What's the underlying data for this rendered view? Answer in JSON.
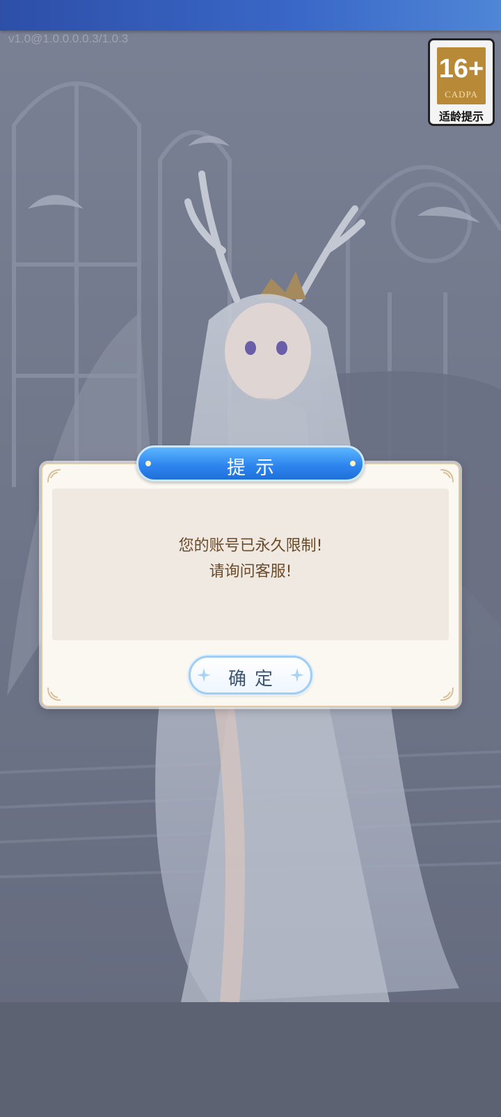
{
  "version_text": "v1.0@1.0.0.0.0.3/1.0.3",
  "age_rating": {
    "age": "16+",
    "org": "CADPA",
    "label": "适龄提示"
  },
  "dialog": {
    "title": "提示",
    "message_line1": "您的账号已永久限制!",
    "message_line2": "请询问客服!",
    "ok_label": "确定"
  },
  "icons": {
    "topbar_emblem": "heart-emblem-icon",
    "corner": "ornament-corner-icon",
    "sparkle": "sparkle-icon"
  },
  "colors": {
    "title_blue": "#2f86ee",
    "message_brown": "#6b4a2a",
    "age_gold": "#b88a38",
    "dim_overlay": "#6d7487"
  }
}
